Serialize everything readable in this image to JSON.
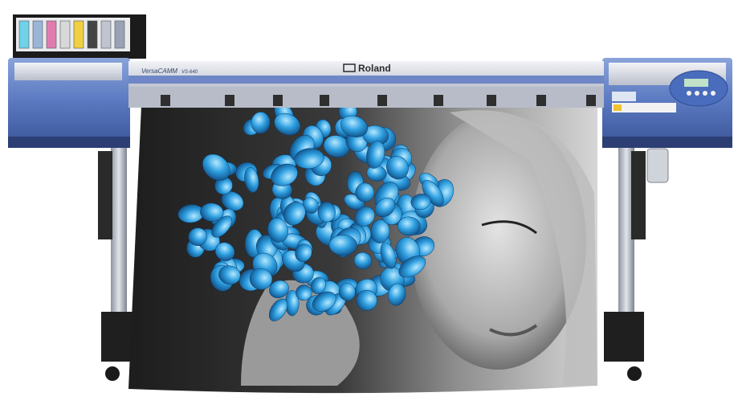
{
  "printer": {
    "brand": "Roland",
    "series": "VersaCAMM",
    "model": "VS-640"
  },
  "colors": {
    "body_blue": "#5a79c0",
    "body_blue_dark": "#3c569a",
    "silver": "#c9cdd6",
    "flower_blue": "#2f9fe0",
    "photo_dark": "#2a2a2a"
  },
  "ink_cartridges": [
    "#6fd2e8",
    "#9ab5d8",
    "#e07bb0",
    "#d8d8d8",
    "#f0d040",
    "#444444",
    "#bfc4cf",
    "#9aa3b5"
  ]
}
